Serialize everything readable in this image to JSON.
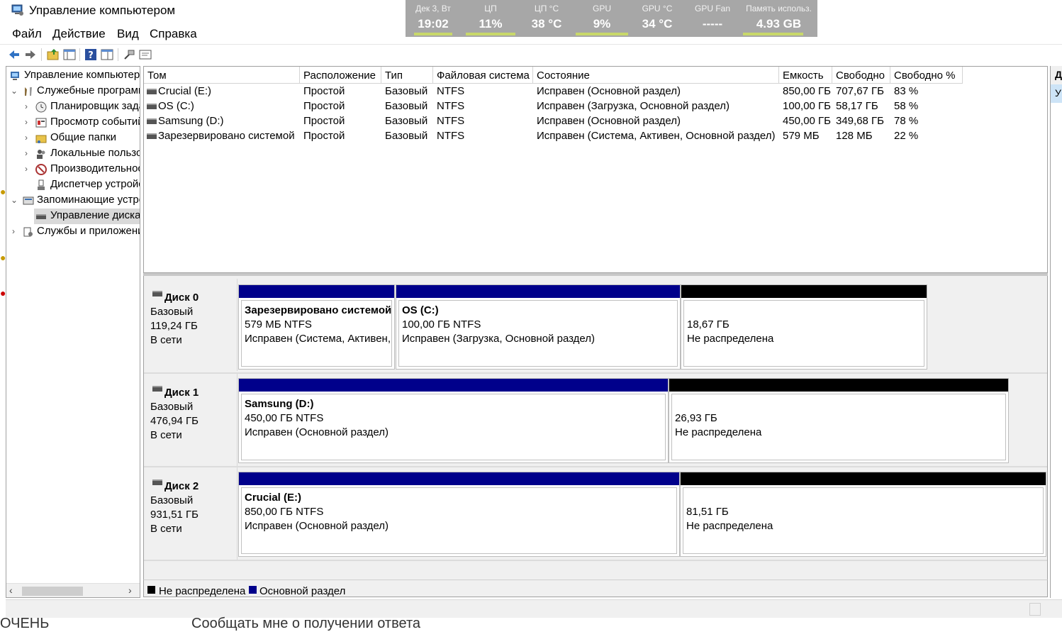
{
  "window": {
    "title": "Управление компьютером"
  },
  "monitor": {
    "cells": [
      {
        "label": "Дек 3, Вт",
        "value": "19:02"
      },
      {
        "label": "ЦП",
        "value": "11%"
      },
      {
        "label": "ЦП °C",
        "value": "38 °C"
      },
      {
        "label": "GPU",
        "value": "9%"
      },
      {
        "label": "GPU °C",
        "value": "34 °C"
      },
      {
        "label": "GPU Fan",
        "value": "-----"
      },
      {
        "label": "Память использ.",
        "value": "4.93 GB"
      }
    ],
    "bar_color": "#c8d86a"
  },
  "menu": {
    "file": "Файл",
    "action": "Действие",
    "view": "Вид",
    "help": "Справка"
  },
  "toolbar": {
    "icons": [
      "back-arrow-icon",
      "forward-arrow-icon",
      "up-folder-icon",
      "show-hide-tree-icon",
      "help-icon",
      "properties-icon",
      "connect-icon",
      "console-icon"
    ]
  },
  "tree": {
    "items": [
      {
        "label": "Управление компьютером (локальным)",
        "icon": "computer-icon"
      },
      {
        "label": "Служебные программы",
        "icon": "tools-icon"
      },
      {
        "label": "Планировщик заданий",
        "icon": "clock-icon"
      },
      {
        "label": "Просмотр событий",
        "icon": "event-viewer-icon"
      },
      {
        "label": "Общие папки",
        "icon": "shared-folder-icon"
      },
      {
        "label": "Локальные пользователи",
        "icon": "users-icon"
      },
      {
        "label": "Производительность",
        "icon": "performance-icon"
      },
      {
        "label": "Диспетчер устройств",
        "icon": "device-manager-icon"
      },
      {
        "label": "Запоминающие устройства",
        "icon": "storage-icon"
      },
      {
        "label": "Управление дисками",
        "icon": "disk-icon"
      },
      {
        "label": "Службы и приложения",
        "icon": "services-icon"
      }
    ]
  },
  "volumes": {
    "columns": [
      "Том",
      "Расположение",
      "Тип",
      "Файловая система",
      "Состояние",
      "Емкость",
      "Свободно",
      "Свободно %"
    ],
    "rows": [
      [
        "Crucial (E:)",
        "Простой",
        "Базовый",
        "NTFS",
        "Исправен (Основной раздел)",
        "850,00 ГБ",
        "707,67 ГБ",
        "83 %"
      ],
      [
        "OS (C:)",
        "Простой",
        "Базовый",
        "NTFS",
        "Исправен (Загрузка, Основной раздел)",
        "100,00 ГБ",
        "58,17 ГБ",
        "58 %"
      ],
      [
        "Samsung (D:)",
        "Простой",
        "Базовый",
        "NTFS",
        "Исправен (Основной раздел)",
        "450,00 ГБ",
        "349,68 ГБ",
        "78 %"
      ],
      [
        "Зарезервировано системой",
        "Простой",
        "Базовый",
        "NTFS",
        "Исправен (Система, Активен, Основной раздел)",
        "579 МБ",
        "128 МБ",
        "22 %"
      ]
    ]
  },
  "disks": [
    {
      "name": "Диск 0",
      "type": "Базовый",
      "size": "119,24 ГБ",
      "status": "В сети",
      "partitions": [
        {
          "title": "Зарезервировано системой",
          "size": "579 МБ NTFS",
          "status": "Исправен (Система, Активен,",
          "kind": "primary"
        },
        {
          "title": "OS  (C:)",
          "size": "100,00 ГБ NTFS",
          "status": "Исправен (Загрузка, Основной раздел)",
          "kind": "primary"
        },
        {
          "title": "",
          "size": "18,67 ГБ",
          "status": "Не распределена",
          "kind": "unallocated"
        }
      ]
    },
    {
      "name": "Диск 1",
      "type": "Базовый",
      "size": "476,94 ГБ",
      "status": "В сети",
      "partitions": [
        {
          "title": "Samsung  (D:)",
          "size": "450,00 ГБ NTFS",
          "status": "Исправен (Основной раздел)",
          "kind": "primary"
        },
        {
          "title": "",
          "size": "26,93 ГБ",
          "status": "Не распределена",
          "kind": "unallocated"
        }
      ]
    },
    {
      "name": "Диск 2",
      "type": "Базовый",
      "size": "931,51 ГБ",
      "status": "В сети",
      "partitions": [
        {
          "title": "Crucial  (E:)",
          "size": "850,00 ГБ NTFS",
          "status": "Исправен (Основной раздел)",
          "kind": "primary"
        },
        {
          "title": "",
          "size": "81,51 ГБ",
          "status": "Не распределена",
          "kind": "unallocated"
        }
      ]
    }
  ],
  "legend": {
    "unallocated": "Не распределена",
    "primary": "Основной раздел"
  },
  "colors": {
    "primary": "#00008b",
    "unallocated": "#000000"
  },
  "actions": {
    "header": "Д",
    "selected": "У"
  },
  "background": {
    "text": "Сообщать мне о получении ответа",
    "left_text": "ОЧЕНЬ"
  }
}
